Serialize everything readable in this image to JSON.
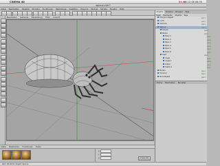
{
  "system_menu": {
    "apple": "",
    "app_name": "CINEMA 4D",
    "user": "Baum",
    "clock": "06.12.08 06:30"
  },
  "window": {
    "title": "spinne.c4d *"
  },
  "main_menu": [
    "Datei",
    "Bearbeiten",
    "Objekte",
    "Struktur",
    "Funktionen",
    "Werkzeuge",
    "Selektion",
    "Plug-Ins",
    "Module",
    "Skripte",
    "Fenster",
    "Hilfe"
  ],
  "viewport": {
    "menu": [
      "Bearbeiten",
      "Kameras",
      "Darstellung",
      "Filter",
      "Ansicht"
    ],
    "accent_color": "#3f7a3f",
    "axis_green": "#3aa43a",
    "axis_red": "#c03030"
  },
  "material_bar": {
    "items": [
      "Datei",
      "Bearbeiten",
      "Funktionen",
      "Textur"
    ]
  },
  "materials": [
    {
      "name": "Mat"
    },
    {
      "name": "Mat.1"
    },
    {
      "name": "Mat.2"
    }
  ],
  "coordinates": {
    "rows": [
      {
        "axis": "X",
        "value": "0 cm"
      },
      {
        "axis": "Y",
        "value": "0 cm"
      },
      {
        "axis": "Z",
        "value": "0 cm"
      }
    ],
    "apply_label": "Anwenden"
  },
  "status": {
    "text": "Zeit: 00:00:01  Objekt: Spinne"
  },
  "right_panel": {
    "tabs": [
      "Objekte",
      "Struktur",
      "Browser",
      "Tags"
    ],
    "subtabs": [
      "Datei",
      "Bearbeiten",
      "Objekte",
      "Tags"
    ],
    "tree": [
      {
        "label": "Polygon-Objekt",
        "indent": 0,
        "selected": false
      },
      {
        "label": "Licht",
        "indent": 0,
        "selected": false
      },
      {
        "label": "Kamera",
        "indent": 0,
        "selected": false
      },
      {
        "label": "Spinne",
        "indent": 0,
        "selected": true
      },
      {
        "label": "Körper",
        "indent": 1,
        "selected": false
      },
      {
        "label": "Beine",
        "indent": 1,
        "selected": false
      },
      {
        "label": "Bein.1",
        "indent": 2,
        "selected": false
      },
      {
        "label": "Bein.2",
        "indent": 2,
        "selected": false
      },
      {
        "label": "Bein.3",
        "indent": 2,
        "selected": false
      },
      {
        "label": "Bein.4",
        "indent": 2,
        "selected": false
      },
      {
        "label": "Bein.5",
        "indent": 2,
        "selected": false
      },
      {
        "label": "Bein.6",
        "indent": 2,
        "selected": false
      },
      {
        "label": "Kopf",
        "indent": 1,
        "selected": false
      },
      {
        "label": "Auge",
        "indent": 2,
        "selected": false
      },
      {
        "label": "Auge.1",
        "indent": 2,
        "selected": false
      },
      {
        "label": "Kiefer",
        "indent": 2,
        "selected": false
      },
      {
        "label": "Kiefer.1",
        "indent": 2,
        "selected": false
      },
      {
        "label": "Boden",
        "indent": 0,
        "selected": false
      },
      {
        "label": "Himmel",
        "indent": 0,
        "selected": false
      },
      {
        "label": "Null-Objekt",
        "indent": 0,
        "selected": false
      }
    ],
    "attr_tabs": [
      "Modus",
      "Bearbeiten",
      "Benutzer"
    ]
  }
}
